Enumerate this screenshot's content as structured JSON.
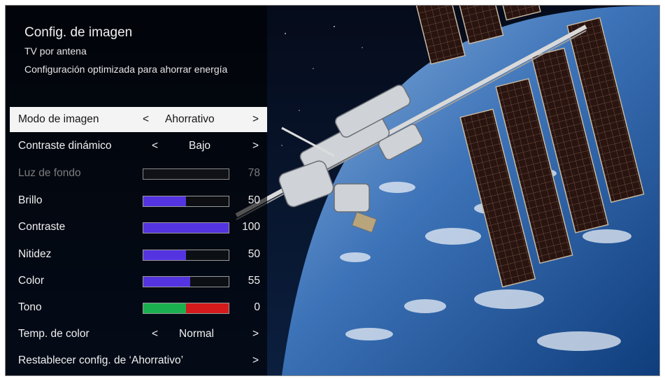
{
  "header": {
    "title": "Config. de imagen",
    "subtitle": "TV por antena",
    "description": "Configuración optimizada para ahorrar energía"
  },
  "arrows": {
    "left": "<",
    "right": ">"
  },
  "menu": {
    "picture_mode": {
      "label": "Modo de imagen",
      "value": "Ahorrativo"
    },
    "dynamic_contrast": {
      "label": "Contraste dinámico",
      "value": "Bajo"
    },
    "backlight": {
      "label": "Luz de fondo",
      "value": 78,
      "value_text": "78"
    },
    "brightness": {
      "label": "Brillo",
      "value": 50,
      "value_text": "50"
    },
    "contrast": {
      "label": "Contraste",
      "value": 100,
      "value_text": "100"
    },
    "sharpness": {
      "label": "Nitidez",
      "value": 50,
      "value_text": "50"
    },
    "color": {
      "label": "Color",
      "value": 55,
      "value_text": "55"
    },
    "tint": {
      "label": "Tono",
      "value": 0,
      "value_text": "0"
    },
    "color_temp": {
      "label": "Temp. de color",
      "value": "Normal"
    },
    "reset": {
      "label": "Restablecer  config. de ‘Ahorrativo’"
    }
  },
  "colors": {
    "slider_fill": "#5433e0",
    "tint_green": "#1bb04f",
    "tint_red": "#d41a1a",
    "selected_bg": "#f4f4f4"
  }
}
